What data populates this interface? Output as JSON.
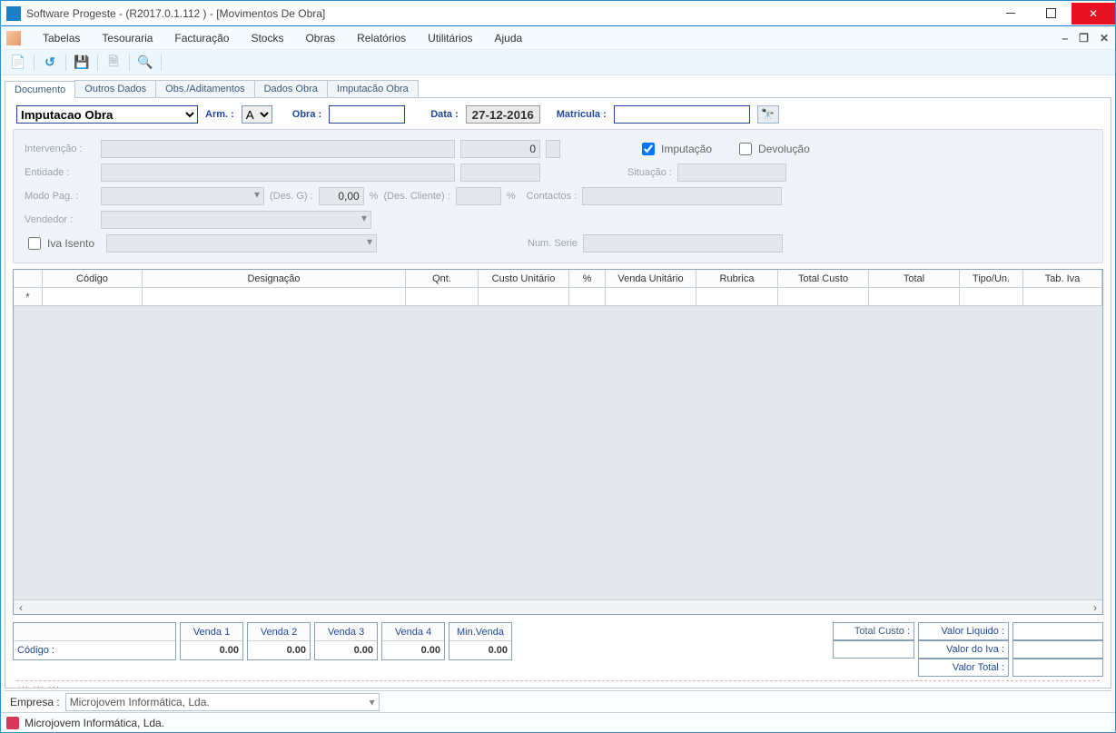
{
  "window": {
    "title": "Software Progeste - (R2017.0.1.112 ) - [Movimentos De Obra]"
  },
  "menu": {
    "items": [
      "Tabelas",
      "Tesouraria",
      "Facturação",
      "Stocks",
      "Obras",
      "Relatórios",
      "Utilitários",
      "Ajuda"
    ]
  },
  "tabs": [
    "Documento",
    "Outros Dados",
    "Obs./Aditamentos",
    "Dados Obra",
    "Imputacão Obra"
  ],
  "topbar": {
    "doc_type": "Imputacao Obra",
    "arm_label": "Arm. :",
    "arm_value": "A",
    "obra_label": "Obra :",
    "obra_value": "",
    "data_label": "Data :",
    "data_value": "27-12-2016",
    "matricula_label": "Matricula :",
    "matricula_value": ""
  },
  "fields": {
    "intervencao_label": "Intervenção :",
    "intervencao_value": "",
    "intervencao_num": "0",
    "imputacao_label": "Imputação",
    "devolucao_label": "Devolução",
    "entidade_label": "Entidade :",
    "situacao_label": "Situação :",
    "modopag_label": "Modo Pag. :",
    "descg_label": "(Des. G) :",
    "descg_value": "0,00",
    "pct": "%",
    "desccliente_label": "(Des. Cliente) :",
    "contactos_label": "Contactos :",
    "vendedor_label": "Vendedor :",
    "ivaisento_label": "Iva Isento",
    "numserie_label": "Num. Serie"
  },
  "grid": {
    "columns": [
      "Código",
      "Designação",
      "Qnt.",
      "Custo Unitário",
      "%",
      "Venda Unitário",
      "Rubrica",
      "Total Custo",
      "Total",
      "Tipo/Un.",
      "Tab. Iva"
    ],
    "new_row_marker": "*"
  },
  "bottom": {
    "codigo_label": "Código :",
    "venda_headers": [
      "Venda 1",
      "Venda 2",
      "Venda 3",
      "Venda 4",
      "Min.Venda"
    ],
    "venda_values": [
      "0.00",
      "0.00",
      "0.00",
      "0.00",
      "0.00"
    ],
    "total_custo_label": "Total Custo :",
    "total_custo_value": "",
    "valor_liquido_label": "Valor Liquido :",
    "valor_iva_label": "Valor do Iva :",
    "valor_total_label": "Valor Total :",
    "dots": "... ... ..."
  },
  "empresa": {
    "label": "Empresa :",
    "value": "Microjovem Informática, Lda."
  },
  "status": {
    "text": "Microjovem Informática, Lda."
  }
}
